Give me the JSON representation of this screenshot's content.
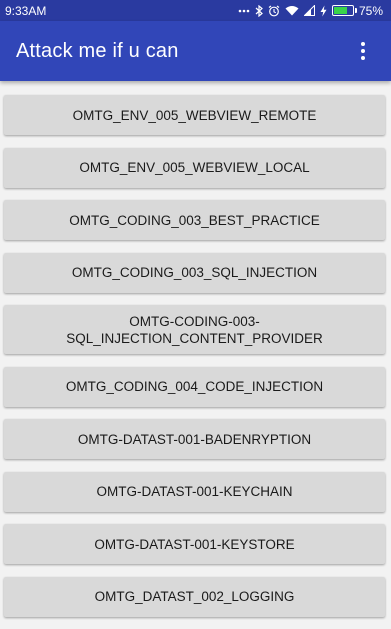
{
  "status_bar": {
    "time": "9:33AM",
    "battery_percent": "75%",
    "battery_level": 0.75,
    "icons": [
      "dots-icon",
      "bluetooth-icon",
      "alarm-icon",
      "wifi-icon",
      "signal-icon",
      "charging-icon",
      "battery-icon"
    ]
  },
  "app_bar": {
    "title": "Attack me if u can",
    "menu_icon": "overflow-menu-icon",
    "color": "#3146b8"
  },
  "buttons": [
    {
      "label": "OMTG_ENV_005_WEBVIEW_REMOTE"
    },
    {
      "label": "OMTG_ENV_005_WEBVIEW_LOCAL"
    },
    {
      "label": "OMTG_CODING_003_BEST_PRACTICE"
    },
    {
      "label": "OMTG_CODING_003_SQL_INJECTION"
    },
    {
      "label": "OMTG-CODING-003-\nSQL_INJECTION_CONTENT_PROVIDER"
    },
    {
      "label": "OMTG_CODING_004_CODE_INJECTION"
    },
    {
      "label": "OMTG-DATAST-001-BADENRYPTION"
    },
    {
      "label": "OMTG-DATAST-001-KEYCHAIN"
    },
    {
      "label": "OMTG-DATAST-001-KEYSTORE"
    },
    {
      "label": "OMTG_DATAST_002_LOGGING"
    }
  ]
}
